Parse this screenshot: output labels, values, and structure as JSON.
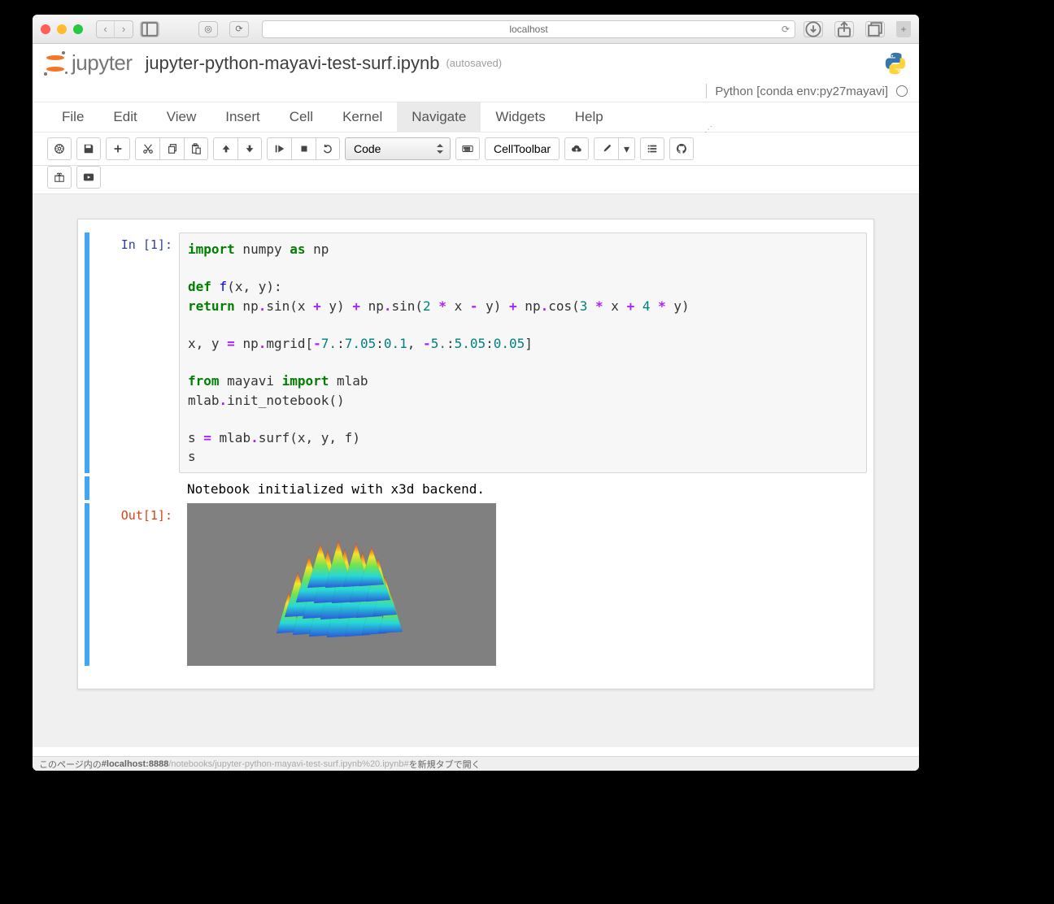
{
  "chrome": {
    "url": "localhost",
    "nav_back": "‹",
    "nav_fwd": "›"
  },
  "header": {
    "logo_text": "jupyter",
    "nb_name": "jupyter-python-mayavi-test-surf.ipynb",
    "autosave": "(autosaved)"
  },
  "kernel": {
    "name": "Python [conda env:py27mayavi]"
  },
  "menu": {
    "items": [
      "File",
      "Edit",
      "View",
      "Insert",
      "Cell",
      "Kernel",
      "Navigate",
      "Widgets",
      "Help"
    ],
    "active_index": 6
  },
  "toolbar": {
    "cell_type": "Code",
    "cell_toolbar": "CellToolbar"
  },
  "cells": {
    "in_label": "In [1]:",
    "out_label": "Out[1]:",
    "code_lines": [
      [
        {
          "t": "import",
          "c": "kw"
        },
        {
          "t": " numpy ",
          "c": "txt"
        },
        {
          "t": "as",
          "c": "kw"
        },
        {
          "t": " np",
          "c": "txt"
        }
      ],
      [],
      [
        {
          "t": "def",
          "c": "kw"
        },
        {
          "t": " ",
          "c": "txt"
        },
        {
          "t": "f",
          "c": "fn"
        },
        {
          "t": "(x, y):",
          "c": "txt"
        }
      ],
      [
        {
          "t": "    ",
          "c": "txt"
        },
        {
          "t": "return",
          "c": "kw"
        },
        {
          "t": " np",
          "c": "txt"
        },
        {
          "t": ".",
          "c": "op"
        },
        {
          "t": "sin(x ",
          "c": "txt"
        },
        {
          "t": "+",
          "c": "op"
        },
        {
          "t": " y) ",
          "c": "txt"
        },
        {
          "t": "+",
          "c": "op"
        },
        {
          "t": " np",
          "c": "txt"
        },
        {
          "t": ".",
          "c": "op"
        },
        {
          "t": "sin(",
          "c": "txt"
        },
        {
          "t": "2",
          "c": "num"
        },
        {
          "t": " ",
          "c": "txt"
        },
        {
          "t": "*",
          "c": "op"
        },
        {
          "t": " x ",
          "c": "txt"
        },
        {
          "t": "-",
          "c": "op"
        },
        {
          "t": " y) ",
          "c": "txt"
        },
        {
          "t": "+",
          "c": "op"
        },
        {
          "t": " np",
          "c": "txt"
        },
        {
          "t": ".",
          "c": "op"
        },
        {
          "t": "cos(",
          "c": "txt"
        },
        {
          "t": "3",
          "c": "num"
        },
        {
          "t": " ",
          "c": "txt"
        },
        {
          "t": "*",
          "c": "op"
        },
        {
          "t": " x ",
          "c": "txt"
        },
        {
          "t": "+",
          "c": "op"
        },
        {
          "t": " ",
          "c": "txt"
        },
        {
          "t": "4",
          "c": "num"
        },
        {
          "t": " ",
          "c": "txt"
        },
        {
          "t": "*",
          "c": "op"
        },
        {
          "t": " y)",
          "c": "txt"
        }
      ],
      [],
      [
        {
          "t": "x, y ",
          "c": "txt"
        },
        {
          "t": "=",
          "c": "op"
        },
        {
          "t": " np",
          "c": "txt"
        },
        {
          "t": ".",
          "c": "op"
        },
        {
          "t": "mgrid[",
          "c": "txt"
        },
        {
          "t": "-",
          "c": "op"
        },
        {
          "t": "7.",
          "c": "num"
        },
        {
          "t": ":",
          "c": "txt"
        },
        {
          "t": "7.05",
          "c": "num"
        },
        {
          "t": ":",
          "c": "txt"
        },
        {
          "t": "0.1",
          "c": "num"
        },
        {
          "t": ", ",
          "c": "txt"
        },
        {
          "t": "-",
          "c": "op"
        },
        {
          "t": "5.",
          "c": "num"
        },
        {
          "t": ":",
          "c": "txt"
        },
        {
          "t": "5.05",
          "c": "num"
        },
        {
          "t": ":",
          "c": "txt"
        },
        {
          "t": "0.05",
          "c": "num"
        },
        {
          "t": "]",
          "c": "txt"
        }
      ],
      [],
      [
        {
          "t": "from",
          "c": "kw"
        },
        {
          "t": " mayavi ",
          "c": "txt"
        },
        {
          "t": "import",
          "c": "kw"
        },
        {
          "t": " mlab",
          "c": "txt"
        }
      ],
      [
        {
          "t": "mlab",
          "c": "txt"
        },
        {
          "t": ".",
          "c": "op"
        },
        {
          "t": "init_notebook()",
          "c": "txt"
        }
      ],
      [],
      [
        {
          "t": "s ",
          "c": "txt"
        },
        {
          "t": "=",
          "c": "op"
        },
        {
          "t": " mlab",
          "c": "txt"
        },
        {
          "t": ".",
          "c": "op"
        },
        {
          "t": "surf(x, y, f)",
          "c": "txt"
        }
      ],
      [
        {
          "t": "s",
          "c": "txt"
        }
      ]
    ],
    "text_output": "Notebook initialized with x3d backend."
  },
  "statusbar": {
    "pre": "このページ内の",
    "bold": "#localhost:8888",
    "dim": "/notebooks/jupyter-python-mayavi-test-surf.ipynb%20.ipynb#",
    "post": "を新規タブで開く"
  }
}
